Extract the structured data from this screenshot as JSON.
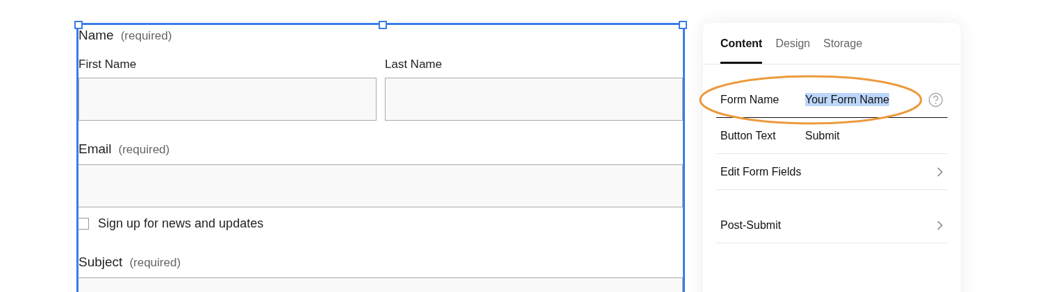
{
  "form": {
    "name_group": {
      "label": "Name",
      "hint": "(required)",
      "fields": [
        {
          "label": "First Name"
        },
        {
          "label": "Last Name"
        }
      ]
    },
    "email": {
      "label": "Email",
      "hint": "(required)"
    },
    "newsletter": {
      "label": "Sign up for news and updates",
      "checked": false
    },
    "subject": {
      "label": "Subject",
      "hint": "(required)"
    }
  },
  "panel": {
    "tabs": [
      {
        "label": "Content",
        "selected": true
      },
      {
        "label": "Design",
        "selected": false
      },
      {
        "label": "Storage",
        "selected": false
      }
    ],
    "rows": [
      {
        "kind": "field",
        "label": "Form Name",
        "value": "Your Form Name",
        "value_selected": true,
        "focused": true,
        "help": true,
        "circled": true
      },
      {
        "kind": "field",
        "label": "Button Text",
        "value": "Submit",
        "value_selected": false,
        "focused": false,
        "help": false,
        "circled": false
      },
      {
        "kind": "link",
        "label": "Edit Form Fields"
      },
      {
        "kind": "link",
        "label": "Post-Submit",
        "spaced": true
      }
    ]
  }
}
